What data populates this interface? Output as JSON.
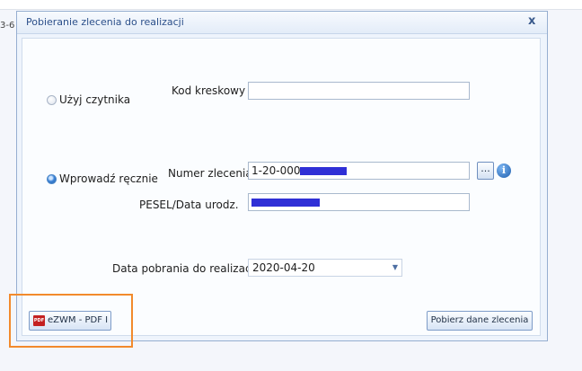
{
  "background": {
    "clipped_text": "3-6"
  },
  "dialog": {
    "title": "Pobieranie zlecenia do realizacji",
    "close_label": "x"
  },
  "options": {
    "reader_radio_label": "Użyj czytnika",
    "manual_radio_label": "Wprowadź ręcznie",
    "selected": "manual"
  },
  "fields": {
    "barcode_label": "Kod kreskowy",
    "barcode_value": "",
    "order_number_label": "Numer zlecenia",
    "order_number_value": "1-20-000",
    "pesel_label": "PESEL/Data urodz.",
    "pesel_value": ""
  },
  "buttons": {
    "browse_label": "...",
    "info_label": "i",
    "pdf_label": "eZWM - PDF I",
    "pdf_icon_text": "PDF",
    "fetch_label": "Pobierz dane zlecenia"
  },
  "date": {
    "label": "Data pobrania do realizacji",
    "value": "2020-04-20"
  },
  "colors": {
    "highlight": "#f28a2c",
    "redaction": "#2f2fd6",
    "radio_selected": "#3b82d6"
  }
}
